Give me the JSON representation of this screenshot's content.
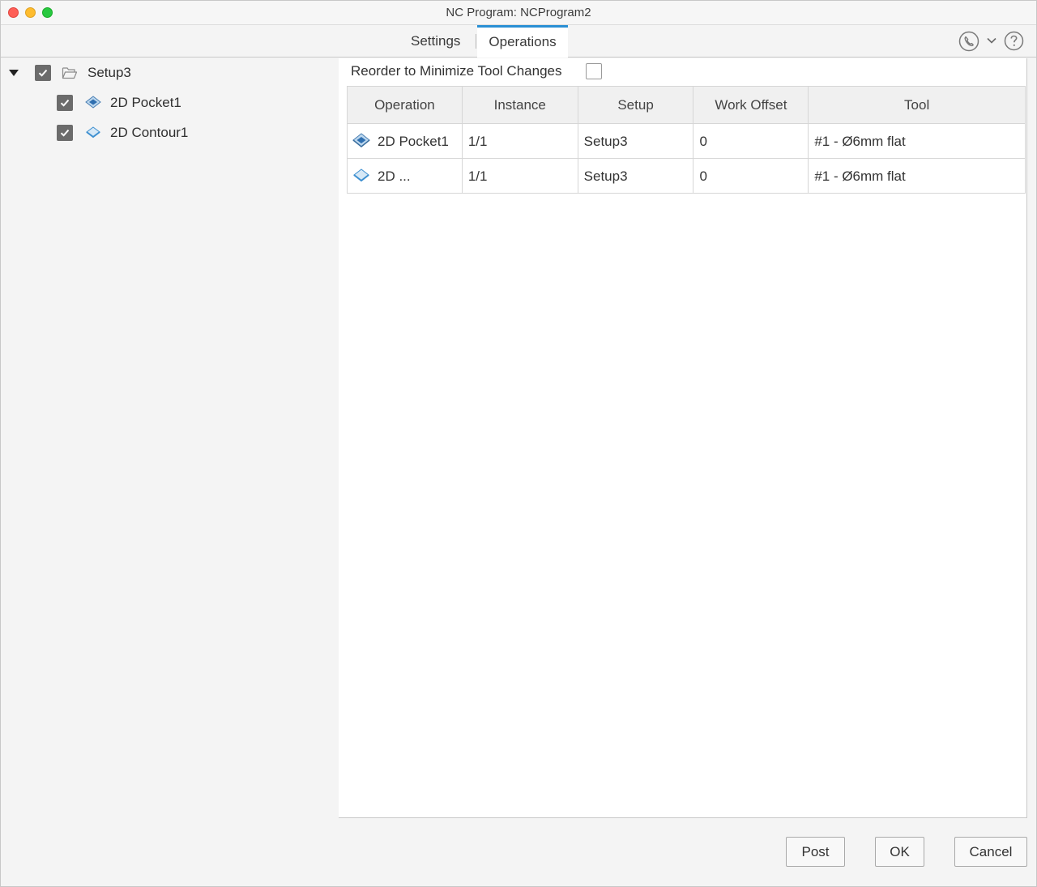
{
  "window": {
    "title": "NC Program: NCProgram2"
  },
  "tabs": [
    {
      "label": "Settings",
      "active": false
    },
    {
      "label": "Operations",
      "active": true
    }
  ],
  "toolbar_icons": [
    "phone-icon",
    "chevron-down-icon",
    "help-icon"
  ],
  "tree": {
    "root": {
      "label": "Setup3",
      "checked": true,
      "expanded": true,
      "icon": "folder-icon"
    },
    "children": [
      {
        "label": "2D Pocket1",
        "checked": true,
        "icon": "pocket-icon"
      },
      {
        "label": "2D Contour1",
        "checked": true,
        "icon": "contour-icon"
      }
    ]
  },
  "reorder": {
    "label": "Reorder to Minimize Tool Changes",
    "checked": false
  },
  "table": {
    "headers": [
      "Operation",
      "Instance",
      "Setup",
      "Work Offset",
      "Tool"
    ],
    "rows": [
      {
        "operation": "2D Pocket1",
        "instance": "1/1",
        "setup": "Setup3",
        "work_offset": "0",
        "tool": "#1 - Ø6mm flat",
        "icon": "pocket-icon"
      },
      {
        "operation": "2D ...",
        "instance": "1/1",
        "setup": "Setup3",
        "work_offset": "0",
        "tool": "#1 - Ø6mm flat",
        "icon": "contour-icon"
      }
    ]
  },
  "buttons": {
    "post": "Post",
    "ok": "OK",
    "cancel": "Cancel"
  },
  "colors": {
    "accent": "#2a8fd4",
    "checkbox_fill": "#6b6b6b"
  }
}
